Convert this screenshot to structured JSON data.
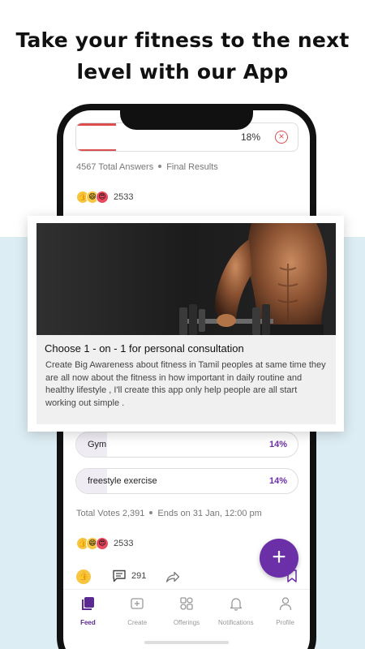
{
  "headline": {
    "line1": "Take your fitness to the next",
    "line2": "level with our App"
  },
  "poll_top": {
    "percent": "18%",
    "fill_fraction": 0.18,
    "total_answers": "4567 Total Answers",
    "results_label": "Final Results",
    "reaction_count": "2533"
  },
  "card": {
    "title": "Choose 1 - on - 1 for personal consultation",
    "description": "Create Big Awareness about fitness in Tamil peoples at same time they are all now about the fitness in how important in daily routine and healthy lifestyle , I'll create this app only help people are all start working out simple ."
  },
  "poll_bottom": {
    "options": [
      {
        "label": "Gym",
        "percent": "14%",
        "fill_fraction": 0.14
      },
      {
        "label": "freestyle exercise",
        "percent": "14%",
        "fill_fraction": 0.14
      }
    ],
    "total_votes": "Total Votes 2,391",
    "ends_on": "Ends on 31 Jan, 12:00 pm",
    "reaction_count": "2533",
    "comment_count": "291"
  },
  "fab": {
    "symbol": "+"
  },
  "tabs": [
    {
      "label": "Feed",
      "icon": "feed-icon",
      "active": true
    },
    {
      "label": "Create",
      "icon": "create-icon",
      "active": false
    },
    {
      "label": "Offerings",
      "icon": "offerings-icon",
      "active": false
    },
    {
      "label": "Notifications",
      "icon": "bell-icon",
      "active": false
    },
    {
      "label": "Profile",
      "icon": "profile-icon",
      "active": false
    }
  ],
  "colors": {
    "accent": "#6b2fa8",
    "poll_bar": "#d94f4f",
    "background_band": "#dcedf3"
  }
}
